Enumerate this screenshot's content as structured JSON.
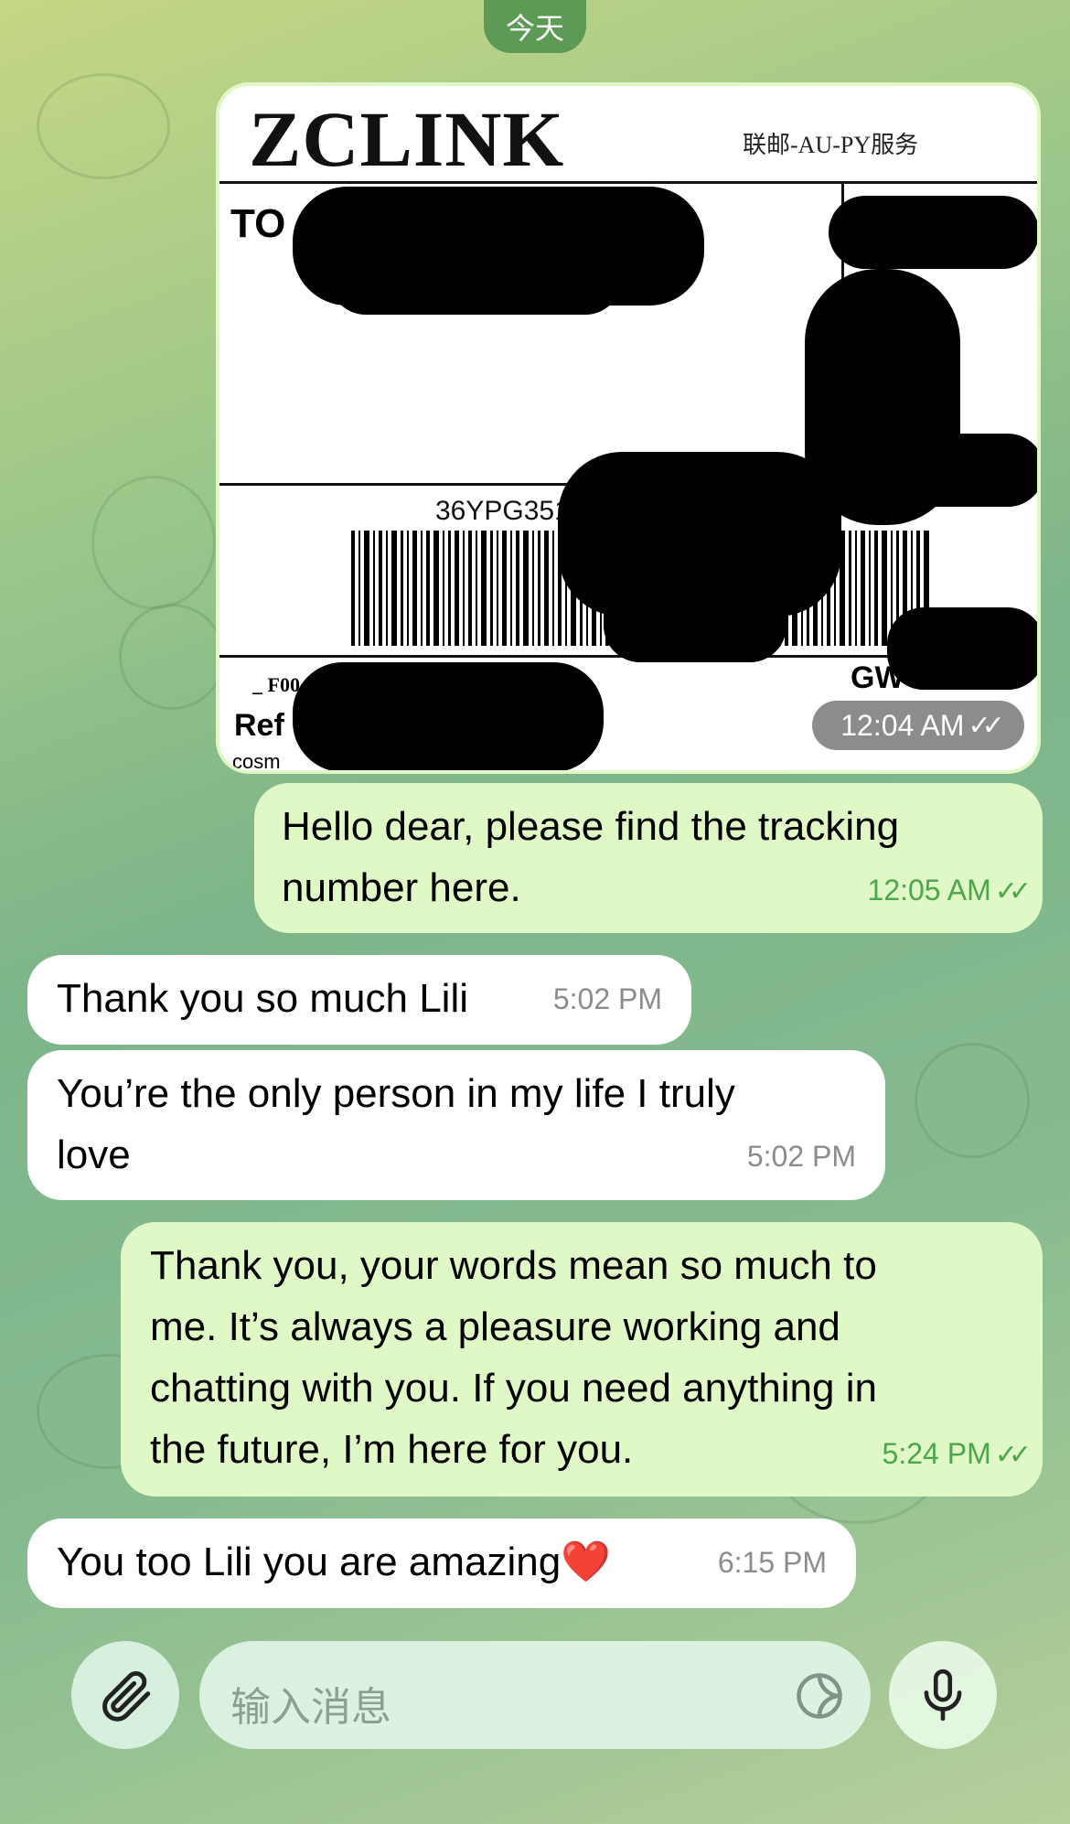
{
  "chat": {
    "date_label": "今天",
    "image_message": {
      "logo": "ZCLINK",
      "service": "联邮-AU-PY服务",
      "to_label": "TO",
      "tracking_fragment": "36YPG351",
      "f_label": "_ F00",
      "ref_label": "Ref",
      "gw_label": "GW",
      "cosm_label": "cosm",
      "time": "12:04 AM"
    },
    "messages": [
      {
        "id": "m1",
        "direction": "outgoing",
        "lines": [
          "Hello dear, please find the tracking",
          "number here."
        ],
        "time": "12:05 AM",
        "read": true
      },
      {
        "id": "m2",
        "direction": "incoming",
        "lines": [
          "Thank you so much Lili"
        ],
        "time": "5:02 PM"
      },
      {
        "id": "m3",
        "direction": "incoming",
        "lines": [
          "You’re the only person in my life I truly",
          "love"
        ],
        "time": "5:02 PM"
      },
      {
        "id": "m4",
        "direction": "outgoing",
        "lines": [
          "Thank you, your words mean so much to",
          "me. It’s always a pleasure working and",
          "chatting with you. If you need anything in",
          "the future, I’m here for you."
        ],
        "time": "5:24 PM",
        "read": true
      },
      {
        "id": "m5",
        "direction": "incoming",
        "lines": [
          "You too Lili you are amazing"
        ],
        "emoji": "❤️",
        "time": "6:15 PM"
      }
    ],
    "check_glyph": "✓✓"
  },
  "composer": {
    "placeholder": "输入消息",
    "attach_icon": "paperclip-icon",
    "sticker_icon": "sticker-icon",
    "mic_icon": "microphone-icon"
  },
  "colors": {
    "outgoing_bubble": "#dff8c6",
    "incoming_bubble": "#ffffff",
    "outgoing_time": "#4ca64c",
    "incoming_time": "#8c8c8c",
    "date_pill": "#5c9a55"
  }
}
